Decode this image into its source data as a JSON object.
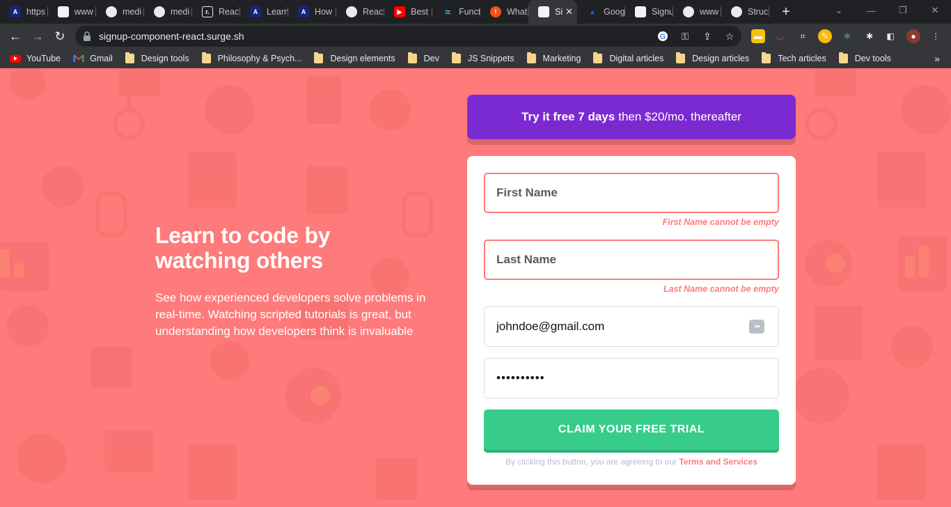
{
  "browser": {
    "tabs": [
      {
        "label": "https",
        "icon": "angular-icon",
        "color": "#1a237e"
      },
      {
        "label": "www",
        "icon": "page-icon",
        "color": "#e8eaed"
      },
      {
        "label": "medi",
        "icon": "globe-icon",
        "color": "#5f6368"
      },
      {
        "label": "medi",
        "icon": "globe-icon",
        "color": "#5f6368"
      },
      {
        "label": "React",
        "icon": "r-icon",
        "color": "#202124"
      },
      {
        "label": "Learn",
        "icon": "angular-icon",
        "color": "#1a237e"
      },
      {
        "label": "How",
        "icon": "angular-icon",
        "color": "#1a237e"
      },
      {
        "label": "React",
        "icon": "globe-icon",
        "color": "#5f6368"
      },
      {
        "label": "Best",
        "icon": "youtube-icon",
        "color": "#ff0000"
      },
      {
        "label": "Funct",
        "icon": "tailwind-icon",
        "color": "#38bdf8"
      },
      {
        "label": "What",
        "icon": "alert-icon",
        "color": "#f4511e"
      },
      {
        "label": "Si",
        "icon": "page-icon",
        "color": "#e8eaed",
        "active": true
      },
      {
        "label": "Goog",
        "icon": "person-icon",
        "color": "#1a73e8"
      },
      {
        "label": "Signu",
        "icon": "page-icon",
        "color": "#e8eaed"
      },
      {
        "label": "www",
        "icon": "globe-icon",
        "color": "#5f6368"
      },
      {
        "label": "Struc",
        "icon": "globe-icon",
        "color": "#5f6368"
      }
    ],
    "new_tab": "+",
    "url": "signup-component-react.surge.sh",
    "bookmarks": [
      {
        "label": "YouTube",
        "icon": "youtube-icon"
      },
      {
        "label": "Gmail",
        "icon": "gmail-icon"
      },
      {
        "label": "Design tools",
        "icon": "folder-icon"
      },
      {
        "label": "Philosophy & Psych...",
        "icon": "folder-icon"
      },
      {
        "label": "Design elements",
        "icon": "folder-icon"
      },
      {
        "label": "Dev",
        "icon": "folder-icon"
      },
      {
        "label": "JS Snippets",
        "icon": "folder-icon"
      },
      {
        "label": "Marketing",
        "icon": "folder-icon"
      },
      {
        "label": "Digital articles",
        "icon": "folder-icon"
      },
      {
        "label": "Design articles",
        "icon": "folder-icon"
      },
      {
        "label": "Tech articles",
        "icon": "folder-icon"
      },
      {
        "label": "Dev tools",
        "icon": "folder-icon"
      }
    ],
    "bookmarks_more": "»"
  },
  "hero": {
    "headline": "Learn to code by watching others",
    "description": "See how experienced developers solve problems in real-time. Watching scripted tutorials is great, but understanding how developers think is invaluable"
  },
  "promo": {
    "bold": "Try it free 7 days",
    "rest": "then $20/mo. thereafter"
  },
  "form": {
    "first_name": {
      "placeholder": "First Name",
      "error": "First Name cannot be empty"
    },
    "last_name": {
      "placeholder": "Last Name",
      "error": "Last Name cannot be empty"
    },
    "email": {
      "value": "johndoe@gmail.com"
    },
    "password": {
      "value": "••••••••••"
    },
    "submit_label": "CLAIM YOUR FREE TRIAL",
    "terms_prefix": "By clicking this button, you are agreeing to our",
    "terms_link": "Terms and Services"
  },
  "colors": {
    "background": "#ff7a7a",
    "promo": "#7b2ad1",
    "cta": "#38cc8b",
    "error": "#ff7a7a"
  }
}
